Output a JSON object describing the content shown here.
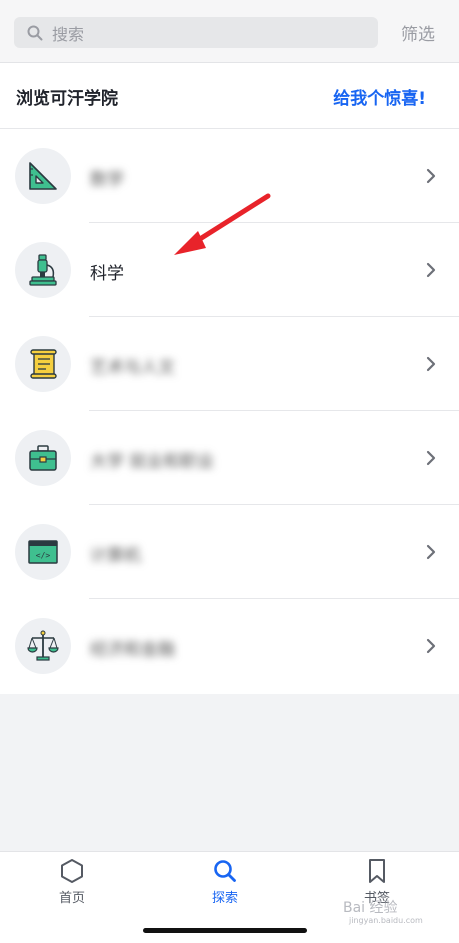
{
  "search": {
    "placeholder": "搜索",
    "filter_label": "筛选"
  },
  "panel": {
    "title": "浏览可汗学院",
    "surprise_label": "给我个惊喜!"
  },
  "categories": [
    {
      "label": "数学",
      "icon": "triangle-ruler-icon",
      "blurred": true
    },
    {
      "label": "科学",
      "icon": "microscope-icon",
      "blurred": false
    },
    {
      "label": "艺术与人文",
      "icon": "scroll-icon",
      "blurred": true
    },
    {
      "label": "大学 就业和职业",
      "icon": "briefcase-icon",
      "blurred": true
    },
    {
      "label": "计算机",
      "icon": "code-window-icon",
      "blurred": true
    },
    {
      "label": "经济和金融",
      "icon": "balance-scale-icon",
      "blurred": true
    }
  ],
  "tabs": [
    {
      "label": "首页",
      "icon": "hexagon-icon",
      "active": false
    },
    {
      "label": "探索",
      "icon": "search-icon",
      "active": true
    },
    {
      "label": "书签",
      "icon": "bookmark-icon",
      "active": false
    }
  ],
  "watermark": {
    "text": "Bai 经验",
    "sub": "jingyan.baidu.com"
  },
  "colors": {
    "accent": "#1865f2",
    "annotation": "#e8232a",
    "icon_green": "#3fbf8f"
  }
}
